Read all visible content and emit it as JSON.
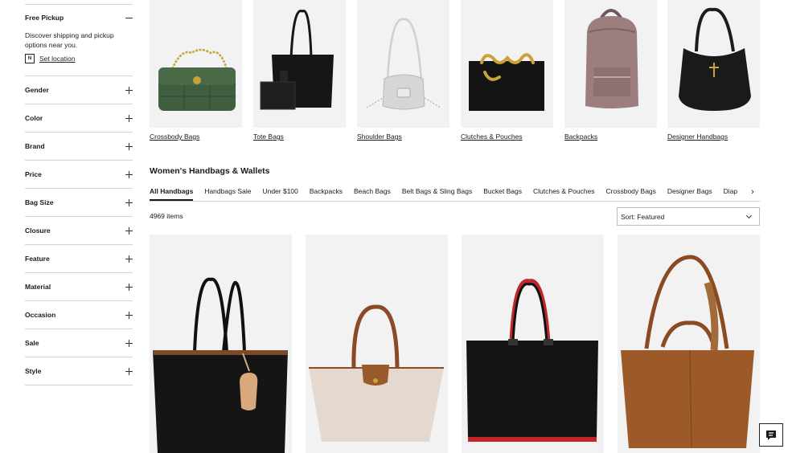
{
  "sidebar": {
    "pickup": {
      "title": "Free Pickup",
      "description": "Discover shipping and pickup options near you.",
      "location_icon": "N",
      "set_location": "Set location"
    },
    "filters": [
      "Gender",
      "Color",
      "Brand",
      "Price",
      "Bag Size",
      "Closure",
      "Feature",
      "Material",
      "Occasion",
      "Sale",
      "Style"
    ]
  },
  "categories": [
    "Crossbody Bags",
    "Tote Bags",
    "Shoulder Bags",
    "Clutches & Pouches",
    "Backpacks",
    "Designer Handbags"
  ],
  "section": {
    "title": "Women's Handbags & Wallets",
    "tabs": [
      "All Handbags",
      "Handbags Sale",
      "Under $100",
      "Backpacks",
      "Beach Bags",
      "Belt Bags & Sling Bags",
      "Bucket Bags",
      "Clutches & Pouches",
      "Crossbody Bags",
      "Designer Bags",
      "Diap"
    ],
    "next_icon": "›",
    "count": "4969 items",
    "sort_label": "Sort: Featured"
  },
  "colors": {
    "green_bag": "#3f5e3f",
    "black_bag": "#161616",
    "silver_bag": "#d6d6d6",
    "mauve_bag": "#9b7e7d",
    "tan_leather": "#9a5a2c",
    "canvas_beige": "#e5d8cf",
    "suede_brown": "#9b5a28",
    "red_lining": "#c0262a",
    "gold": "#c9a23a"
  }
}
